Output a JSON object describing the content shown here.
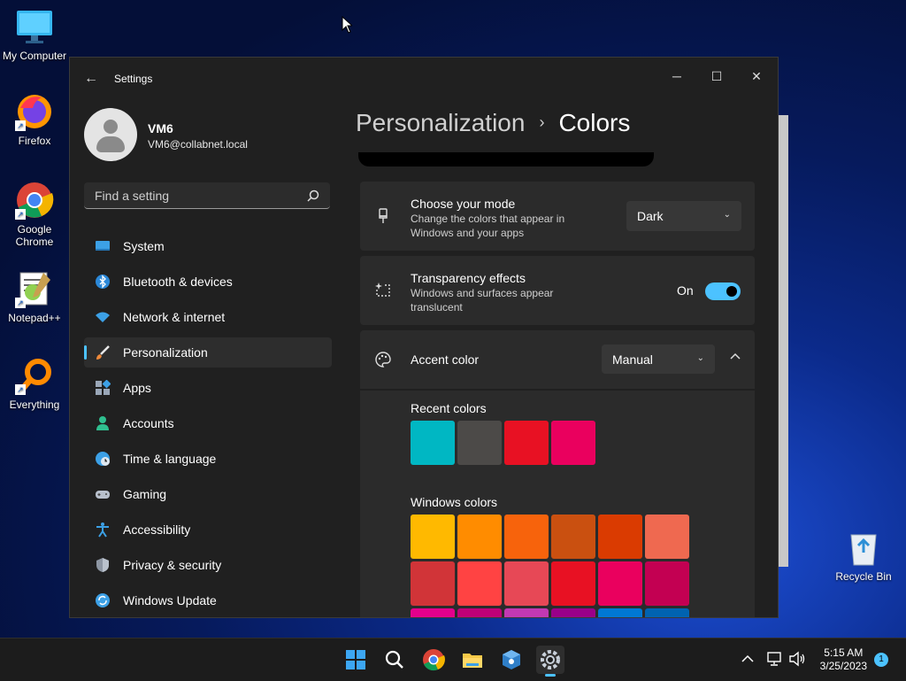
{
  "desktop": {
    "icons": [
      {
        "label": "My Computer"
      },
      {
        "label": "Firefox"
      },
      {
        "label": "Google Chrome"
      },
      {
        "label": "Notepad++"
      },
      {
        "label": "Everything"
      },
      {
        "label": "Recycle Bin"
      }
    ]
  },
  "window": {
    "title": "Settings",
    "back_icon": "back-arrow-icon",
    "controls": {
      "minimize": "─",
      "maximize": "☐",
      "close": "✕"
    }
  },
  "user": {
    "name": "VM6",
    "email": "VM6@collabnet.local"
  },
  "search": {
    "placeholder": "Find a setting"
  },
  "nav": {
    "items": [
      {
        "label": "System",
        "icon": "monitor-icon"
      },
      {
        "label": "Bluetooth & devices",
        "icon": "bluetooth-icon"
      },
      {
        "label": "Network & internet",
        "icon": "wifi-icon"
      },
      {
        "label": "Personalization",
        "icon": "brush-icon",
        "active": true
      },
      {
        "label": "Apps",
        "icon": "apps-icon"
      },
      {
        "label": "Accounts",
        "icon": "person-icon"
      },
      {
        "label": "Time & language",
        "icon": "globe-clock-icon"
      },
      {
        "label": "Gaming",
        "icon": "gamepad-icon"
      },
      {
        "label": "Accessibility",
        "icon": "accessibility-icon"
      },
      {
        "label": "Privacy & security",
        "icon": "shield-icon"
      },
      {
        "label": "Windows Update",
        "icon": "update-icon"
      }
    ]
  },
  "main": {
    "breadcrumb_parent": "Personalization",
    "breadcrumb_sep": "›",
    "breadcrumb_current": "Colors",
    "mode": {
      "title": "Choose your mode",
      "desc": "Change the colors that appear in Windows and your apps",
      "value": "Dark"
    },
    "transparency": {
      "title": "Transparency effects",
      "desc": "Windows and surfaces appear translucent",
      "state_label": "On",
      "enabled": true
    },
    "accent": {
      "title": "Accent color",
      "value": "Manual",
      "recent_label": "Recent colors",
      "recent_colors": [
        "#00b7c3",
        "#4c4a48",
        "#e81123",
        "#ea005e"
      ],
      "windows_label": "Windows colors",
      "windows_colors": [
        "#ffb900",
        "#ff8c00",
        "#f7630c",
        "#ca5010",
        "#da3b01",
        "#ef6950",
        "#d13438",
        "#ff4343",
        "#e74856",
        "#e81123",
        "#ea005e",
        "#c30052",
        "#e3008c",
        "#bf0077",
        "#c239b3",
        "#9a0089",
        "#0078d4",
        "#0063b1"
      ]
    }
  },
  "taskbar": {
    "time": "5:15 AM",
    "date": "3/25/2023",
    "notification_count": "1"
  },
  "colors": {
    "accent": "#4cc2ff",
    "window_bg": "#202020",
    "card_bg": "#2b2b2b"
  }
}
